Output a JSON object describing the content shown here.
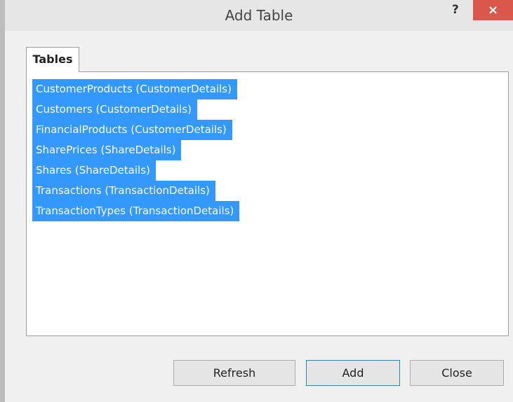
{
  "window": {
    "title": "Add Table",
    "help_glyph": "?",
    "close_glyph": "×"
  },
  "tabs": [
    {
      "label": "Tables"
    }
  ],
  "tables": [
    "CustomerProducts (CustomerDetails)",
    "Customers (CustomerDetails)",
    "FinancialProducts (CustomerDetails)",
    "SharePrices (ShareDetails)",
    "Shares (ShareDetails)",
    "Transactions (TransactionDetails)",
    "TransactionTypes (TransactionDetails)"
  ],
  "buttons": {
    "refresh": "Refresh",
    "add": "Add",
    "close": "Close"
  },
  "colors": {
    "selection": "#3399ff",
    "close_button": "#d9584b"
  }
}
